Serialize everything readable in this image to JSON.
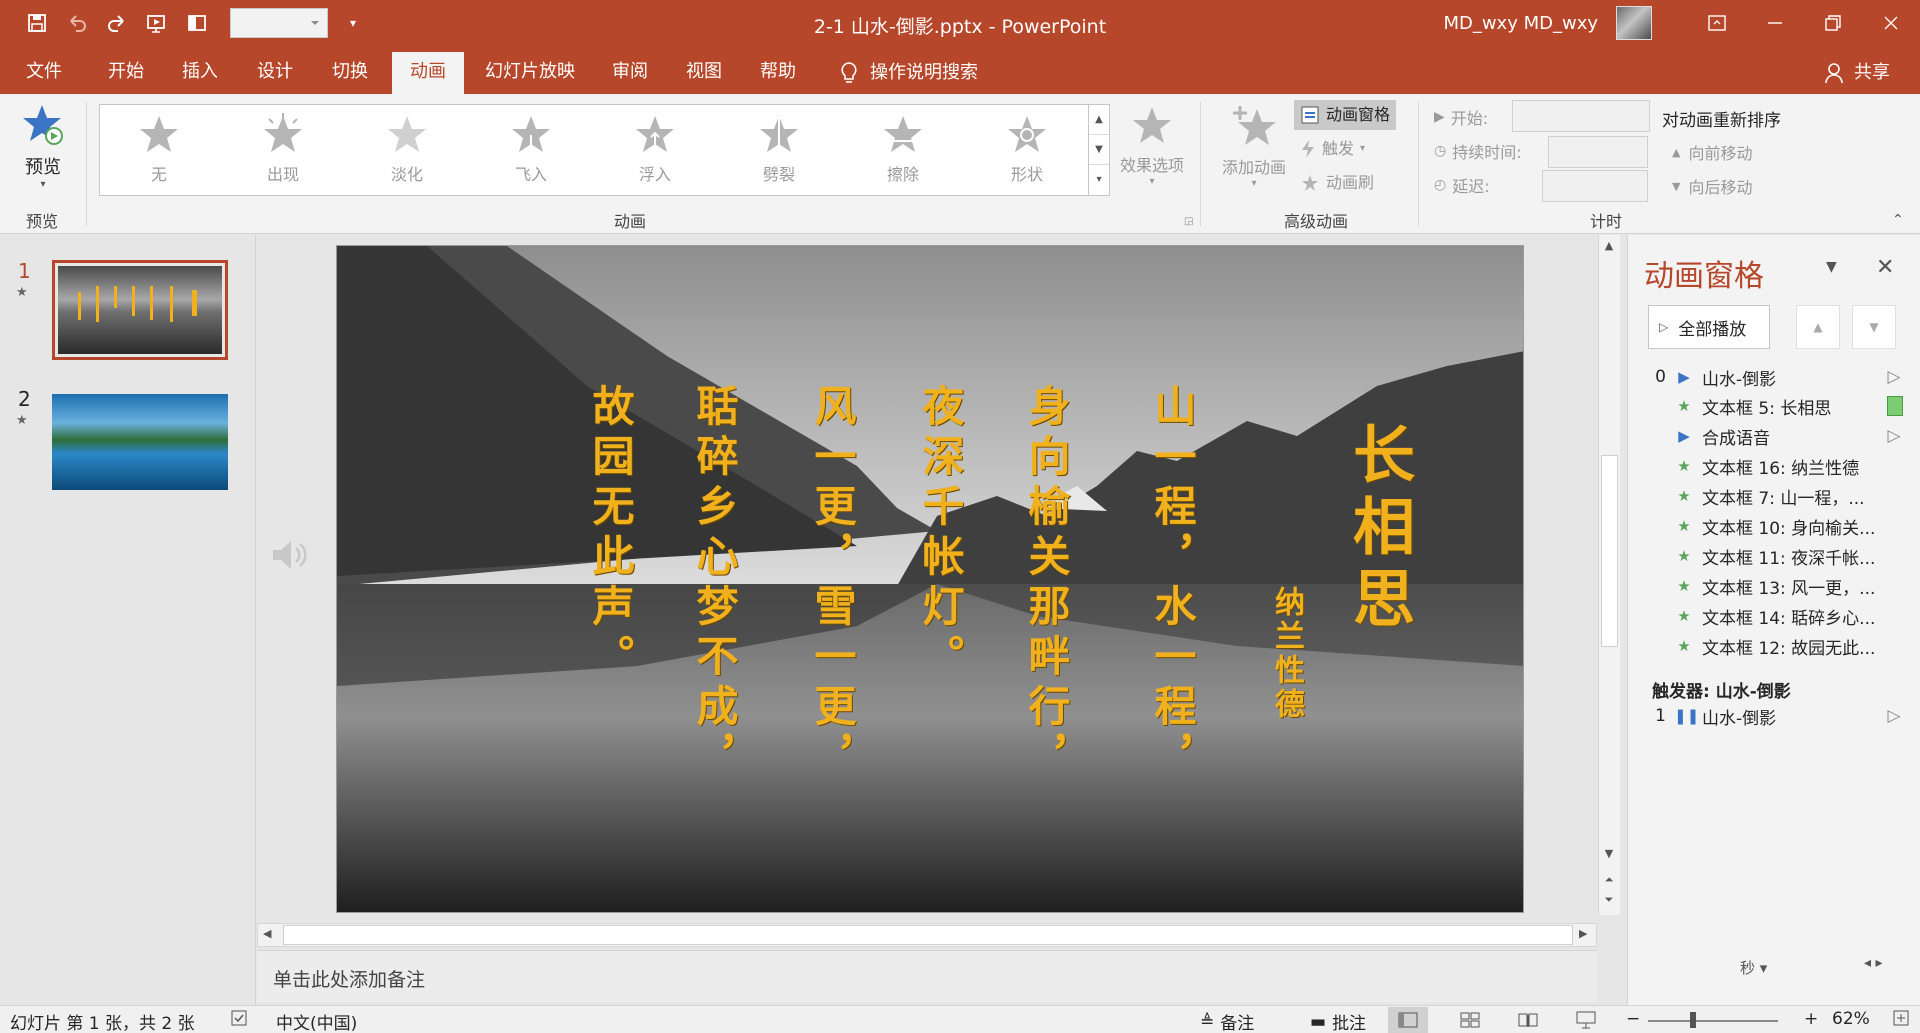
{
  "window": {
    "title": "2-1 山水-倒影.pptx  -  PowerPoint",
    "user": "MD_wxy MD_wxy"
  },
  "tabs": [
    {
      "label": "文件",
      "active": false
    },
    {
      "label": "开始",
      "active": false
    },
    {
      "label": "插入",
      "active": false
    },
    {
      "label": "设计",
      "active": false
    },
    {
      "label": "切换",
      "active": false
    },
    {
      "label": "动画",
      "active": true
    },
    {
      "label": "幻灯片放映",
      "active": false
    },
    {
      "label": "审阅",
      "active": false
    },
    {
      "label": "视图",
      "active": false
    },
    {
      "label": "帮助",
      "active": false
    }
  ],
  "tell_me": "操作说明搜索",
  "share": "共享",
  "ribbon": {
    "preview_button": "预览",
    "preview_group": "预览",
    "animation_group": "动画",
    "gallery": [
      "无",
      "出现",
      "淡化",
      "飞入",
      "浮入",
      "劈裂",
      "擦除",
      "形状"
    ],
    "effect_options": "效果选项",
    "advanced": {
      "group": "高级动画",
      "add_animation": "添加动画",
      "animation_pane": "动画窗格",
      "trigger": "触发",
      "painter": "动画刷"
    },
    "timing": {
      "group": "计时",
      "start": "开始:",
      "duration": "持续时间:",
      "delay": "延迟:",
      "reorder_title": "对动画重新排序",
      "move_earlier": "向前移动",
      "move_later": "向后移动"
    }
  },
  "slides": [
    {
      "number": "1",
      "active": true
    },
    {
      "number": "2",
      "active": false
    }
  ],
  "slide_poem": {
    "title": "长相思",
    "author": "纳兰性德",
    "lines": [
      "山一程，水一程，",
      "身向榆关那畔行，",
      "夜深千帐灯。",
      "风一更，雪一更，",
      "聒碎乡心梦不成，",
      "故园无此声。"
    ]
  },
  "notes_placeholder": "单击此处添加备注",
  "anim_pane": {
    "title": "动画窗格",
    "play_all": "全部播放",
    "items": [
      {
        "idx": "0",
        "icon": "play",
        "label": "山水-倒影",
        "end": "▷"
      },
      {
        "idx": "",
        "icon": "star",
        "label": "文本框 5: 长相思",
        "end": "bar"
      },
      {
        "idx": "",
        "icon": "play",
        "label": "合成语音",
        "end": "▷"
      },
      {
        "idx": "",
        "icon": "star",
        "label": "文本框 16: 纳兰性德",
        "end": ""
      },
      {
        "idx": "",
        "icon": "star",
        "label": "文本框 7: 山一程，...",
        "end": ""
      },
      {
        "idx": "",
        "icon": "star",
        "label": "文本框 10: 身向榆关...",
        "end": ""
      },
      {
        "idx": "",
        "icon": "star",
        "label": "文本框 11: 夜深千帐...",
        "end": ""
      },
      {
        "idx": "",
        "icon": "star",
        "label": "文本框 13: 风一更，...",
        "end": ""
      },
      {
        "idx": "",
        "icon": "star",
        "label": "文本框 14: 聒碎乡心...",
        "end": ""
      },
      {
        "idx": "",
        "icon": "star",
        "label": "文本框 12: 故园无此...",
        "end": ""
      }
    ],
    "trigger_label": "触发器: 山水-倒影",
    "trigger_item": {
      "idx": "1",
      "label": "山水-倒影"
    },
    "seconds": "秒"
  },
  "status": {
    "slide_info": "幻灯片 第 1 张，共 2 张",
    "language": "中文(中国)",
    "notes": "备注",
    "comments": "批注",
    "zoom": "62%"
  },
  "colors": {
    "accent": "#b7472a",
    "poem_text": "#f1b11d"
  }
}
